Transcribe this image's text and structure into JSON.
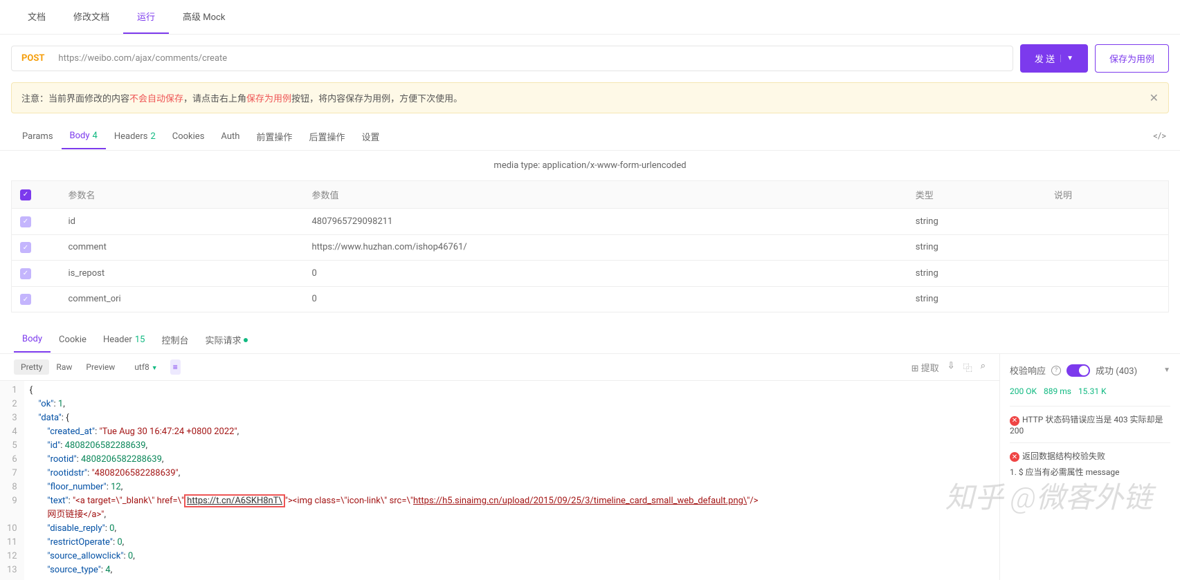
{
  "topTabs": [
    "文档",
    "修改文档",
    "运行",
    "高级 Mock"
  ],
  "topActive": 2,
  "method": "POST",
  "url": "https://weibo.com/ajax/comments/create",
  "sendLabel": "发 送",
  "saveLabel": "保存为用例",
  "notice": {
    "prefix": "注意：当前界面修改的内容 ",
    "red1": "不会自动保存",
    "mid": " ，请点击右上角 ",
    "red2": "保存为用例",
    "suffix": " 按钮，将内容保存为用例，方便下次使用。"
  },
  "subTabs": [
    {
      "label": "Params"
    },
    {
      "label": "Body",
      "badge": "4"
    },
    {
      "label": "Headers",
      "badge": "2"
    },
    {
      "label": "Cookies"
    },
    {
      "label": "Auth"
    },
    {
      "label": "前置操作"
    },
    {
      "label": "后置操作"
    },
    {
      "label": "设置"
    }
  ],
  "subActive": 1,
  "mediaType": "media type: application/x-www-form-urlencoded",
  "paramHeaders": [
    "",
    "参数名",
    "参数值",
    "类型",
    "说明"
  ],
  "params": [
    {
      "name": "id",
      "value": "4807965729098211",
      "type": "string"
    },
    {
      "name": "comment",
      "value": "https://www.huzhan.com/ishop46761/",
      "type": "string"
    },
    {
      "name": "is_repost",
      "value": "0",
      "type": "string"
    },
    {
      "name": "comment_ori",
      "value": "0",
      "type": "string"
    }
  ],
  "respTabs": [
    {
      "label": "Body"
    },
    {
      "label": "Cookie"
    },
    {
      "label": "Header",
      "badge": "15"
    },
    {
      "label": "控制台"
    },
    {
      "label": "实际请求",
      "dot": true
    }
  ],
  "respActive": 0,
  "toolBtns": [
    "Pretty",
    "Raw",
    "Preview"
  ],
  "toolActive": 0,
  "enc": "utf8",
  "extractLabel": "提取",
  "json": {
    "created_at": "Tue Aug 30 16:47:24 +0800 2022",
    "id": "4808206582288639",
    "rootid": "4808206582288639",
    "rootidstr": "4808206582288639",
    "floor_number": "12",
    "hl_url": "https://t.cn/A6SKH8nT",
    "img_url": "https://h5.sinaimg.cn/upload/2015/09/25/3/timeline_card_small_web_default.png",
    "link_text": "网页链接",
    "disable_reply": "0",
    "restrictOperate": "0",
    "source_allowclick": "0",
    "source_type": "4"
  },
  "verify": {
    "label": "校验响应",
    "status": "成功 (403)"
  },
  "statusLine": {
    "code": "200 OK",
    "time": "889 ms",
    "size": "15.31 K"
  },
  "errors": [
    {
      "msg": "HTTP 状态码错误应当是 403 实际却是 200"
    },
    {
      "msg": "返回数据结构校验失败",
      "sub": "1. $ 应当有必需属性 message"
    }
  ],
  "watermark": "知乎 @微客外链"
}
